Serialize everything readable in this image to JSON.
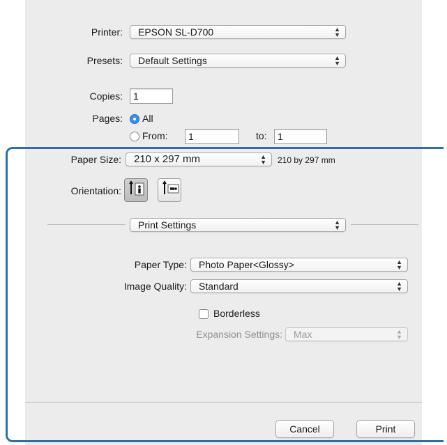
{
  "printer": {
    "label": "Printer:",
    "value": "EPSON SL-D700"
  },
  "presets": {
    "label": "Presets:",
    "value": "Default Settings"
  },
  "copies": {
    "label": "Copies:",
    "value": "1"
  },
  "pages": {
    "label": "Pages:",
    "all_label": "All",
    "from_label": "From:",
    "from_value": "1",
    "to_label": "to:",
    "to_value": "1",
    "selected": "All"
  },
  "paper_size": {
    "label": "Paper Size:",
    "value": "210 x 297 mm",
    "description": "210 by 297 mm"
  },
  "orientation": {
    "label": "Orientation:",
    "selected": "portrait"
  },
  "section": {
    "value": "Print Settings"
  },
  "paper_type": {
    "label": "Paper Type:",
    "value": "Photo Paper<Glossy>"
  },
  "image_quality": {
    "label": "Image Quality:",
    "value": "Standard"
  },
  "borderless": {
    "label": "Borderless",
    "checked": false
  },
  "expansion": {
    "label": "Expansion Settings:",
    "value": "Max",
    "enabled": false
  },
  "buttons": {
    "cancel": "Cancel",
    "print": "Print"
  },
  "colors": {
    "highlight_border": "#2d6fa6",
    "radio_selected": "#3b8fe6",
    "dialog_bg": "#ececec"
  }
}
